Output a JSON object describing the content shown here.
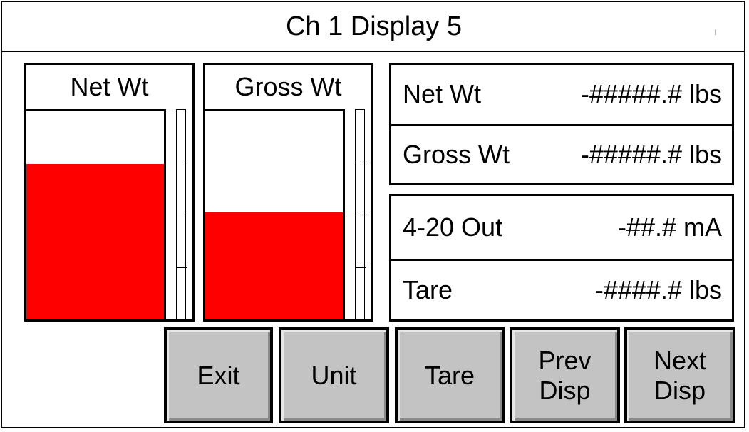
{
  "title": "Ch 1 Display 5",
  "bars": [
    {
      "label": "Net Wt",
      "fill_fraction": 0.745
    },
    {
      "label": "Gross Wt",
      "fill_fraction": 0.515
    }
  ],
  "readouts": {
    "weights": [
      {
        "label": "Net Wt",
        "value": "-#####.# lbs"
      },
      {
        "label": "Gross Wt",
        "value": "-#####.# lbs"
      }
    ],
    "other": [
      {
        "label": "4-20 Out",
        "value": "-##.# mA"
      },
      {
        "label": "Tare",
        "value": "-####.# lbs"
      }
    ]
  },
  "buttons": {
    "exit": "Exit",
    "unit": "Unit",
    "tare": "Tare",
    "prev": "Prev\nDisp",
    "next": "Next\nDisp"
  },
  "colors": {
    "bar_fill": "#ff0000",
    "button_face": "#c3c3c3"
  }
}
